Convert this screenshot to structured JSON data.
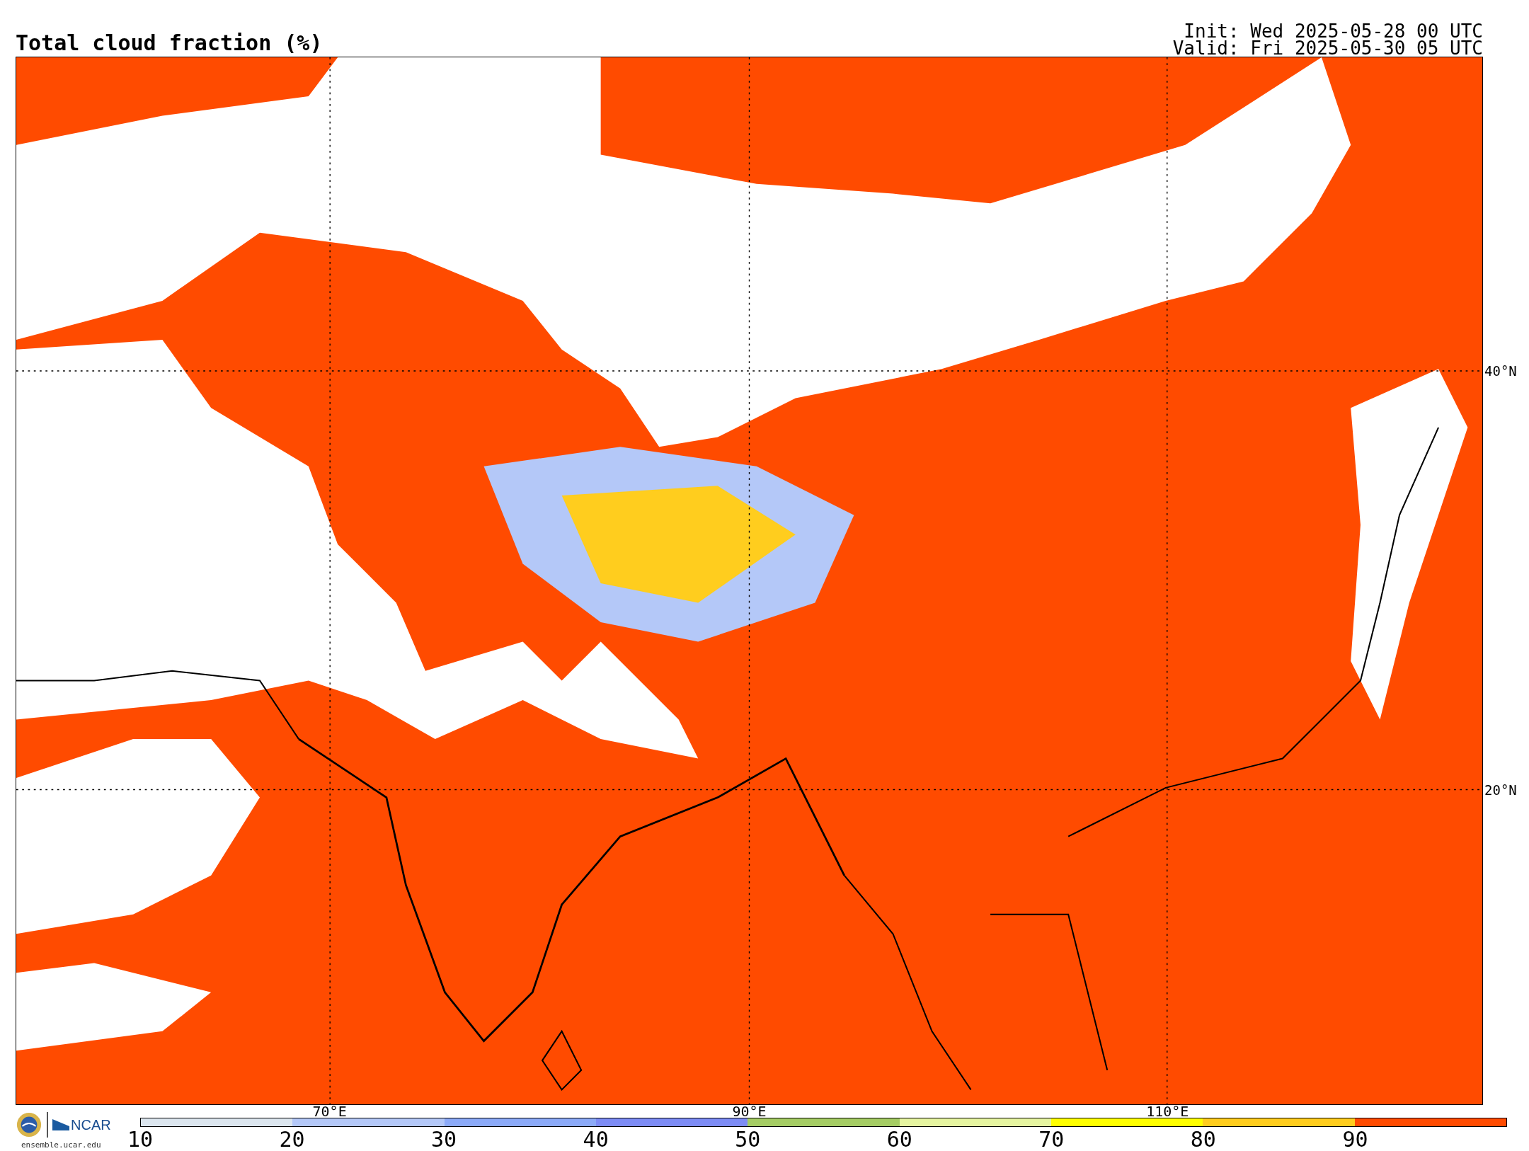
{
  "title": "Total cloud fraction (%)",
  "times": [
    "Init: Wed 2025-05-28 00 UTC",
    "Valid: Fri 2025-05-30 05 UTC"
  ],
  "map": {
    "lat_labels": [
      "40°N",
      "20°N"
    ],
    "lon_labels": [
      "70°E",
      "90°E",
      "110°E"
    ]
  },
  "logo": {
    "name": "NCAR",
    "url": "ensemble.ucar.edu"
  },
  "colorbar": {
    "bins": [
      {
        "label": "10",
        "color": "#dce6ef"
      },
      {
        "label": "20",
        "color": "#b4c8f8"
      },
      {
        "label": "30",
        "color": "#8caaf8"
      },
      {
        "label": "40",
        "color": "#7d8cf5"
      },
      {
        "label": "50",
        "color": "#a5cd64"
      },
      {
        "label": "60",
        "color": "#e6f5a0"
      },
      {
        "label": "70",
        "color": "#ffff00"
      },
      {
        "label": "80",
        "color": "#ffcd1e"
      },
      {
        "label": "90",
        "color": "#ff4b00"
      }
    ]
  }
}
